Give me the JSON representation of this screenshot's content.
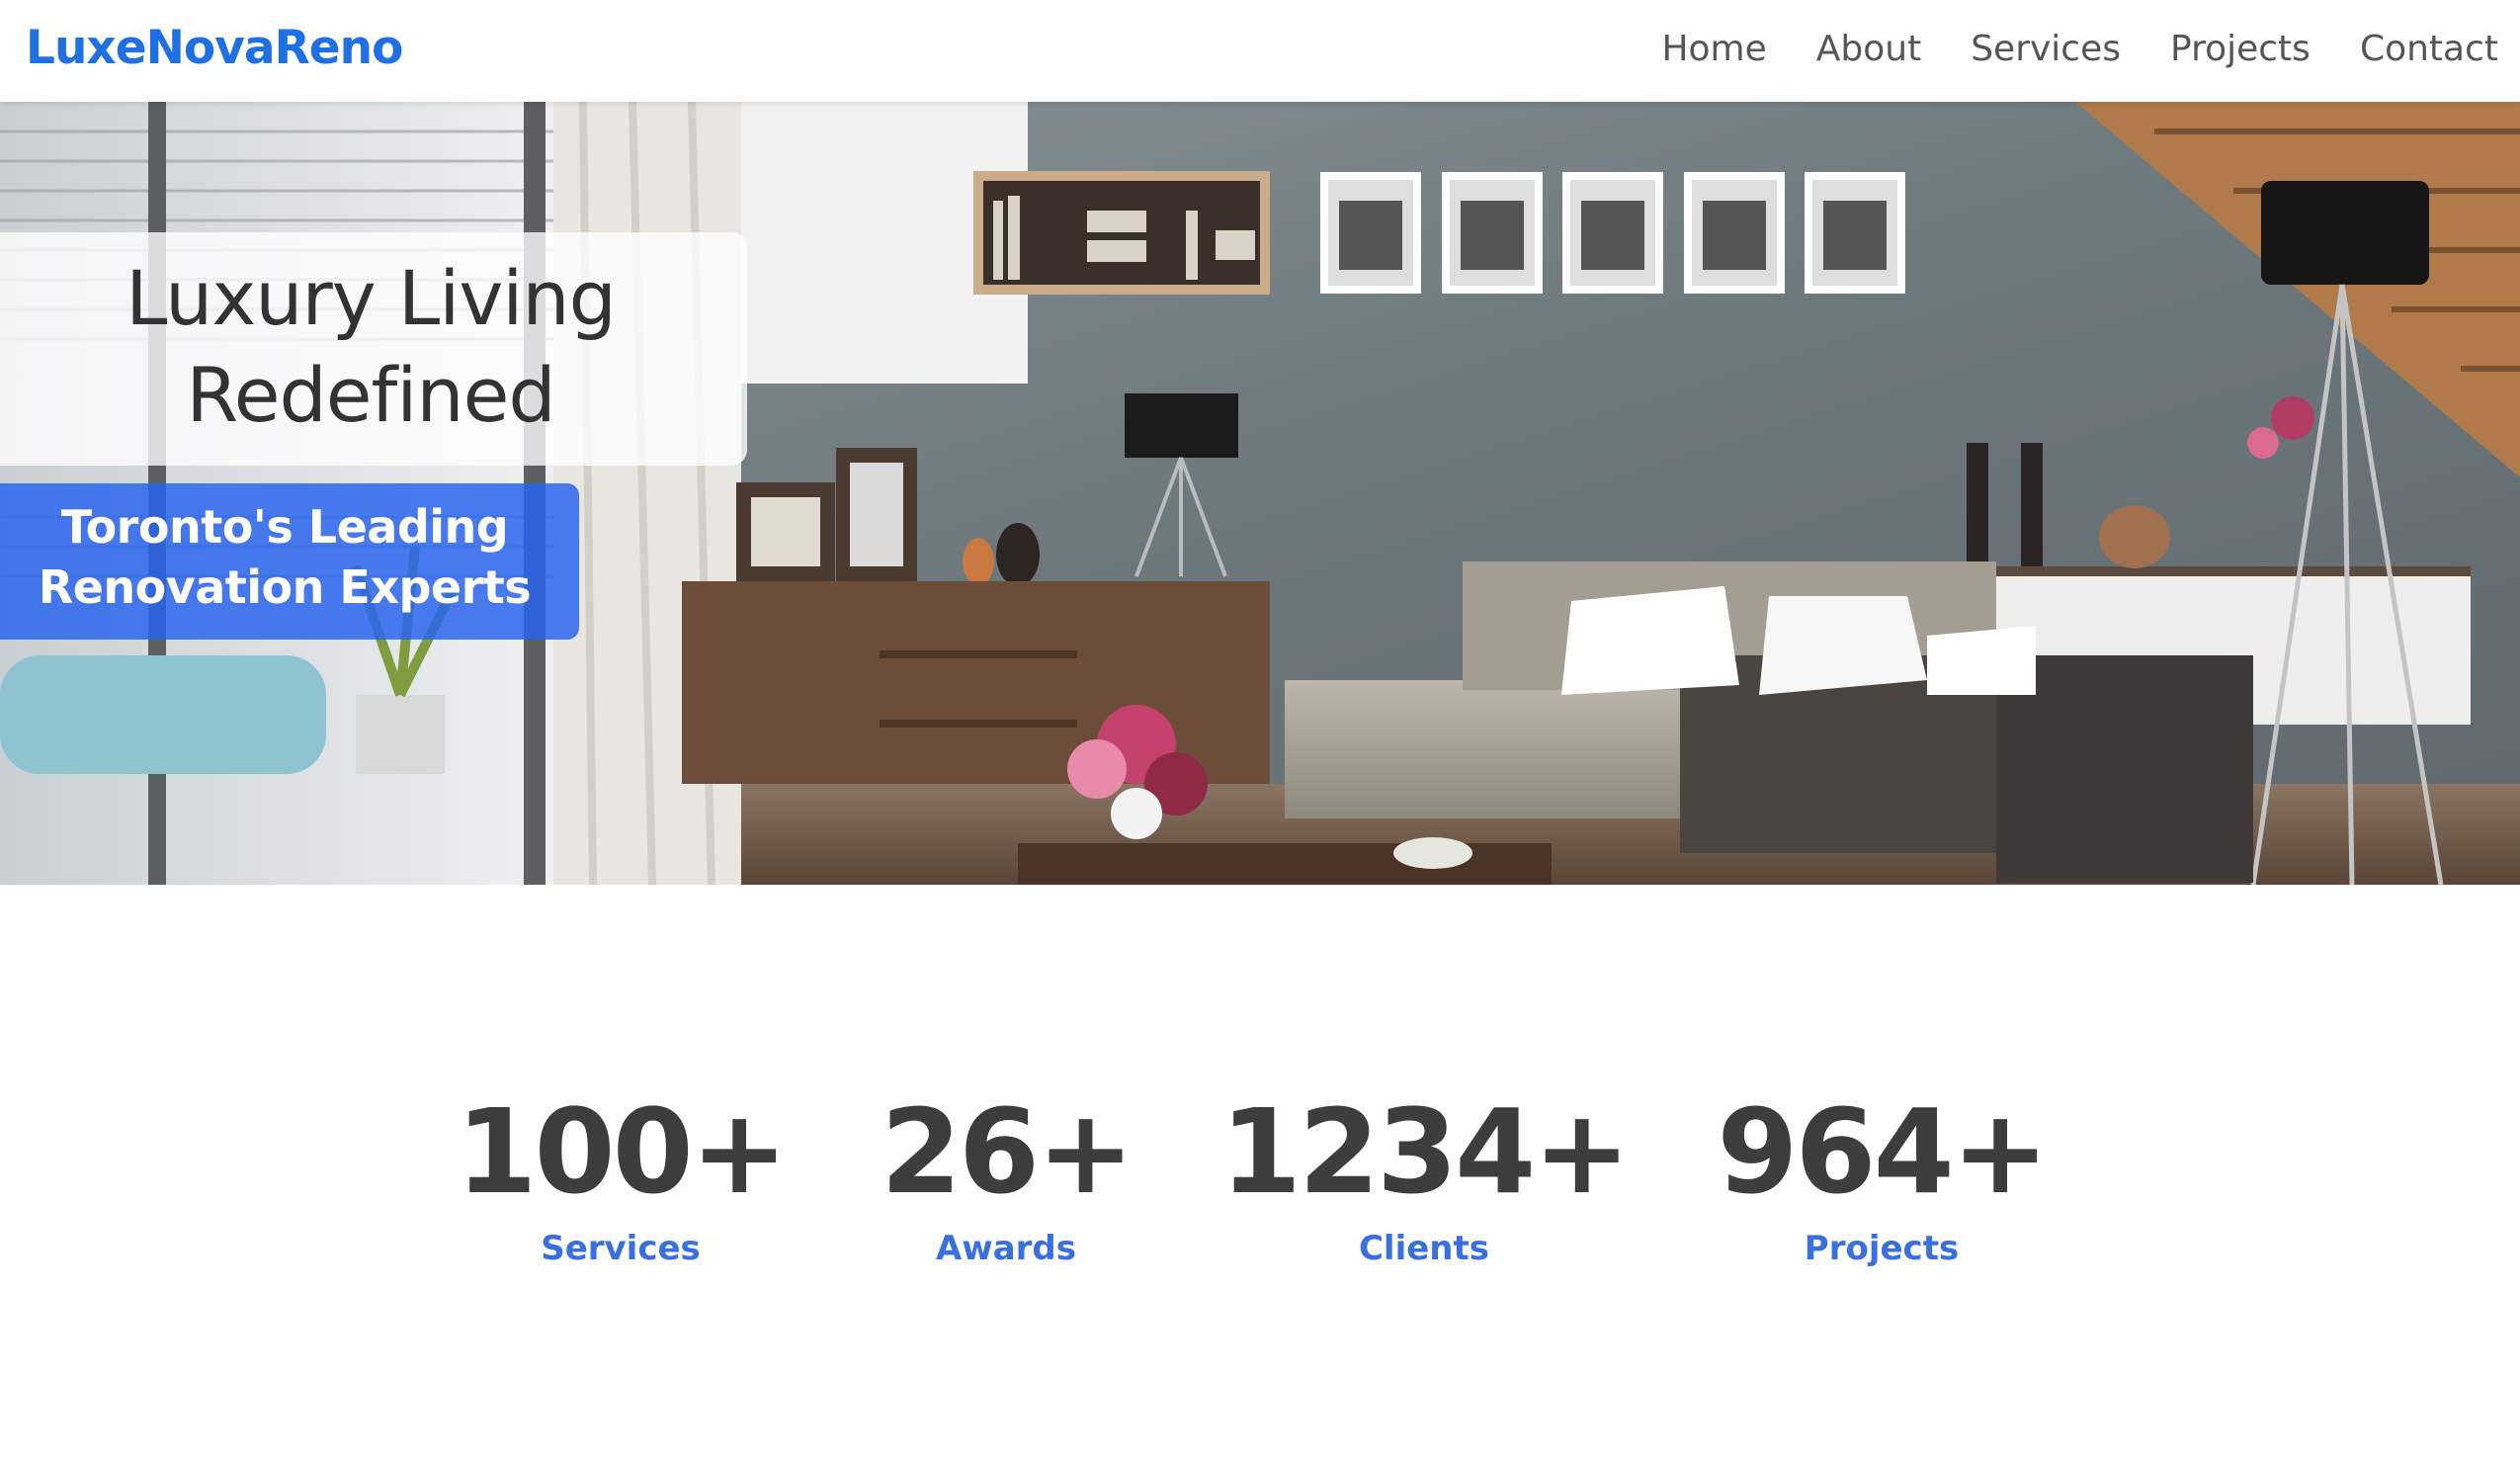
{
  "header": {
    "brand": "LuxeNovaReno",
    "nav": [
      "Home",
      "About",
      "Services",
      "Projects",
      "Contact"
    ]
  },
  "hero": {
    "title": "Luxury Living\nRedefined",
    "tagline": "Toronto's Leading\nRenovation Experts"
  },
  "stats": [
    {
      "value": "100+",
      "label": "Services"
    },
    {
      "value": "26+",
      "label": "Awards"
    },
    {
      "value": "1234+",
      "label": "Clients"
    },
    {
      "value": "964+",
      "label": "Projects"
    }
  ],
  "colors": {
    "brand": "#1f6fe5",
    "nav_text": "#555555",
    "tag_background": "#2864ee",
    "stat_value": "#3d3d3d",
    "stat_label": "#3a6fe0"
  }
}
